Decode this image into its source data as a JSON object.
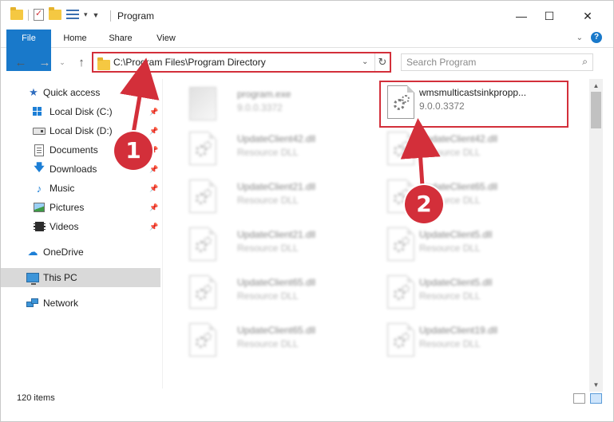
{
  "window": {
    "title": "Program",
    "controls": {
      "minimize": "—",
      "maximize": "☐",
      "close": "✕"
    }
  },
  "ribbon": {
    "tabs": [
      {
        "label": "File"
      },
      {
        "label": "Home"
      },
      {
        "label": "Share"
      },
      {
        "label": "View"
      }
    ],
    "help": "?"
  },
  "navigation": {
    "address_path": "C:\\Program Files\\Program Directory",
    "search_placeholder": "Search Program"
  },
  "sidebar": {
    "items": [
      {
        "label": "Quick access",
        "icon": "star-icon"
      },
      {
        "label": "Local Disk (C:)",
        "icon": "windows-drive-icon",
        "pinned": true
      },
      {
        "label": "Local Disk (D:)",
        "icon": "drive-icon",
        "pinned": true
      },
      {
        "label": "Documents",
        "icon": "documents-icon",
        "pinned": true
      },
      {
        "label": "Downloads",
        "icon": "download-icon",
        "pinned": true
      },
      {
        "label": "Music",
        "icon": "music-icon",
        "pinned": true
      },
      {
        "label": "Pictures",
        "icon": "pictures-icon",
        "pinned": true
      },
      {
        "label": "Videos",
        "icon": "videos-icon",
        "pinned": true
      },
      {
        "label": "OneDrive",
        "icon": "cloud-icon"
      },
      {
        "label": "This PC",
        "icon": "computer-icon",
        "selected": true
      },
      {
        "label": "Network",
        "icon": "network-icon"
      }
    ]
  },
  "files": {
    "left_column": [
      {
        "name": "program.exe",
        "meta": "9.0.0.3372",
        "type": "exe"
      },
      {
        "name": "UpdateClient42.dll",
        "meta": "Resource DLL",
        "type": "dll"
      },
      {
        "name": "UpdateClient21.dll",
        "meta": "Resource DLL",
        "type": "dll"
      },
      {
        "name": "UpdateClient21.dll",
        "meta": "Resource DLL",
        "type": "dll"
      },
      {
        "name": "UpdateClient65.dll",
        "meta": "Resource DLL",
        "type": "dll"
      },
      {
        "name": "UpdateClient65.dll",
        "meta": "Resource DLL",
        "type": "dll"
      }
    ],
    "right_column": [
      {
        "name": "wmsmulticastsinkpropp...",
        "meta": "9.0.0.3372",
        "type": "dll",
        "highlighted": true
      },
      {
        "name": "UpdateClient42.dll",
        "meta": "Resource DLL",
        "type": "dll"
      },
      {
        "name": "UpdateClient65.dll",
        "meta": "Resource DLL",
        "type": "dll"
      },
      {
        "name": "UpdateClient5.dll",
        "meta": "Resource DLL",
        "type": "dll"
      },
      {
        "name": "UpdateClient5.dll",
        "meta": "Resource DLL",
        "type": "dll"
      },
      {
        "name": "UpdateClient19.dll",
        "meta": "Resource DLL",
        "type": "dll"
      }
    ]
  },
  "status": {
    "item_count": "120 items"
  },
  "annotations": {
    "step_one": "1",
    "step_two": "2",
    "accent_color": "#d32f3a"
  }
}
